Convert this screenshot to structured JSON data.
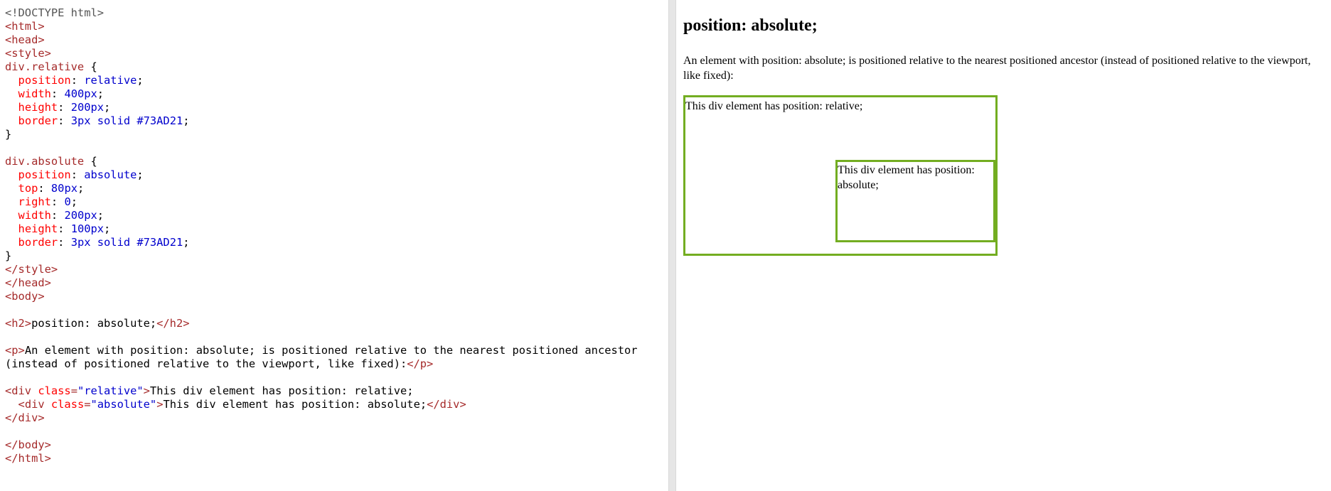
{
  "editor": {
    "lines": [
      [
        {
          "t": "doc",
          "s": "<!DOCTYPE html>"
        }
      ],
      [
        {
          "t": "tag",
          "s": "<html>"
        }
      ],
      [
        {
          "t": "tag",
          "s": "<head>"
        }
      ],
      [
        {
          "t": "tag",
          "s": "<style>"
        }
      ],
      [
        {
          "t": "sel",
          "s": "div.relative"
        },
        {
          "t": "txt",
          "s": " {"
        }
      ],
      [
        {
          "t": "txt",
          "s": "  "
        },
        {
          "t": "prop",
          "s": "position"
        },
        {
          "t": "txt",
          "s": ": "
        },
        {
          "t": "val",
          "s": "relative"
        },
        {
          "t": "txt",
          "s": ";"
        }
      ],
      [
        {
          "t": "txt",
          "s": "  "
        },
        {
          "t": "prop",
          "s": "width"
        },
        {
          "t": "txt",
          "s": ": "
        },
        {
          "t": "val",
          "s": "400px"
        },
        {
          "t": "txt",
          "s": ";"
        }
      ],
      [
        {
          "t": "txt",
          "s": "  "
        },
        {
          "t": "prop",
          "s": "height"
        },
        {
          "t": "txt",
          "s": ": "
        },
        {
          "t": "val",
          "s": "200px"
        },
        {
          "t": "txt",
          "s": ";"
        }
      ],
      [
        {
          "t": "txt",
          "s": "  "
        },
        {
          "t": "prop",
          "s": "border"
        },
        {
          "t": "txt",
          "s": ": "
        },
        {
          "t": "val",
          "s": "3px solid #73AD21"
        },
        {
          "t": "txt",
          "s": ";"
        }
      ],
      [
        {
          "t": "txt",
          "s": "}"
        }
      ],
      [
        {
          "t": "txt",
          "s": ""
        }
      ],
      [
        {
          "t": "sel",
          "s": "div.absolute"
        },
        {
          "t": "txt",
          "s": " {"
        }
      ],
      [
        {
          "t": "txt",
          "s": "  "
        },
        {
          "t": "prop",
          "s": "position"
        },
        {
          "t": "txt",
          "s": ": "
        },
        {
          "t": "val",
          "s": "absolute"
        },
        {
          "t": "txt",
          "s": ";"
        }
      ],
      [
        {
          "t": "txt",
          "s": "  "
        },
        {
          "t": "prop",
          "s": "top"
        },
        {
          "t": "txt",
          "s": ": "
        },
        {
          "t": "val",
          "s": "80px"
        },
        {
          "t": "txt",
          "s": ";"
        }
      ],
      [
        {
          "t": "txt",
          "s": "  "
        },
        {
          "t": "prop",
          "s": "right"
        },
        {
          "t": "txt",
          "s": ": "
        },
        {
          "t": "val",
          "s": "0"
        },
        {
          "t": "txt",
          "s": ";"
        }
      ],
      [
        {
          "t": "txt",
          "s": "  "
        },
        {
          "t": "prop",
          "s": "width"
        },
        {
          "t": "txt",
          "s": ": "
        },
        {
          "t": "val",
          "s": "200px"
        },
        {
          "t": "txt",
          "s": ";"
        }
      ],
      [
        {
          "t": "txt",
          "s": "  "
        },
        {
          "t": "prop",
          "s": "height"
        },
        {
          "t": "txt",
          "s": ": "
        },
        {
          "t": "val",
          "s": "100px"
        },
        {
          "t": "txt",
          "s": ";"
        }
      ],
      [
        {
          "t": "txt",
          "s": "  "
        },
        {
          "t": "prop",
          "s": "border"
        },
        {
          "t": "txt",
          "s": ": "
        },
        {
          "t": "val",
          "s": "3px solid #73AD21"
        },
        {
          "t": "txt",
          "s": ";"
        }
      ],
      [
        {
          "t": "txt",
          "s": "}"
        }
      ],
      [
        {
          "t": "tag",
          "s": "</style>"
        }
      ],
      [
        {
          "t": "tag",
          "s": "</head>"
        }
      ],
      [
        {
          "t": "tag",
          "s": "<body>"
        }
      ],
      [
        {
          "t": "txt",
          "s": ""
        }
      ],
      [
        {
          "t": "tag",
          "s": "<h2>"
        },
        {
          "t": "txt",
          "s": "position: absolute;"
        },
        {
          "t": "tag",
          "s": "</h2>"
        }
      ],
      [
        {
          "t": "txt",
          "s": ""
        }
      ],
      [
        {
          "t": "tag",
          "s": "<p>"
        },
        {
          "t": "txt",
          "s": "An element with position: absolute; is positioned relative to the nearest positioned ancestor"
        }
      ],
      [
        {
          "t": "txt",
          "s": "(instead of positioned relative to the viewport, like fixed):"
        },
        {
          "t": "tag",
          "s": "</p>"
        }
      ],
      [
        {
          "t": "txt",
          "s": ""
        }
      ],
      [
        {
          "t": "tag",
          "s": "<div "
        },
        {
          "t": "attr",
          "s": "class"
        },
        {
          "t": "tag",
          "s": "="
        },
        {
          "t": "attrv",
          "s": "\"relative\""
        },
        {
          "t": "tag",
          "s": ">"
        },
        {
          "t": "txt",
          "s": "This div element has position: relative;"
        }
      ],
      [
        {
          "t": "txt",
          "s": "  "
        },
        {
          "t": "tag",
          "s": "<div "
        },
        {
          "t": "attr",
          "s": "class"
        },
        {
          "t": "tag",
          "s": "="
        },
        {
          "t": "attrv",
          "s": "\"absolute\""
        },
        {
          "t": "tag",
          "s": ">"
        },
        {
          "t": "txt",
          "s": "This div element has position: absolute;"
        },
        {
          "t": "tag",
          "s": "</div>"
        }
      ],
      [
        {
          "t": "tag",
          "s": "</div>"
        }
      ],
      [
        {
          "t": "txt",
          "s": ""
        }
      ],
      [
        {
          "t": "tag",
          "s": "</body>"
        }
      ],
      [
        {
          "t": "tag",
          "s": "</html>"
        }
      ]
    ]
  },
  "preview": {
    "heading": "position: absolute;",
    "paragraph": "An element with position: absolute; is positioned relative to the nearest positioned ancestor (instead of positioned relative to the viewport, like fixed):",
    "relative_text": "This div element has position: relative;",
    "absolute_text": "This div element has position: absolute;",
    "border_color": "#73AD21"
  }
}
